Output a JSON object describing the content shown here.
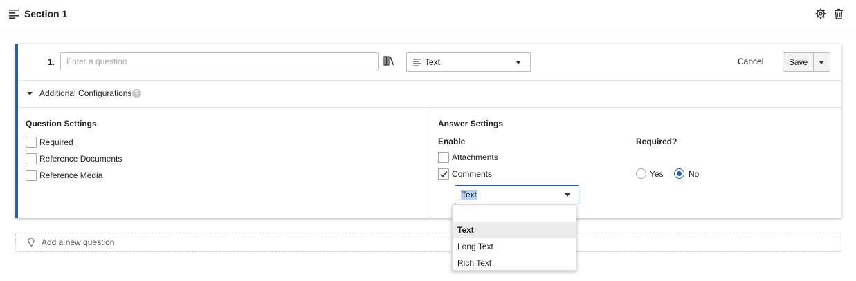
{
  "section": {
    "title": "Section 1"
  },
  "question": {
    "number": "1.",
    "placeholder": "Enter a question",
    "type_value": "Text",
    "cancel_label": "Cancel",
    "save_label": "Save"
  },
  "additional_config": {
    "label": "Additional Configurations",
    "help": "?"
  },
  "question_settings": {
    "heading": "Question Settings",
    "options": [
      {
        "label": "Required",
        "checked": false
      },
      {
        "label": "Reference Documents",
        "checked": false
      },
      {
        "label": "Reference Media",
        "checked": false
      }
    ]
  },
  "answer_settings": {
    "heading": "Answer Settings",
    "enable_heading": "Enable",
    "required_heading": "Required?",
    "attachments_label": "Attachments",
    "attachments_checked": false,
    "comments_label": "Comments",
    "comments_checked": true,
    "radio_yes": "Yes",
    "radio_no": "No",
    "selected_required": "No",
    "comment_type_value": "Text"
  },
  "dropdown": {
    "options": [
      "Text",
      "Long Text",
      "Rich Text"
    ],
    "selected": "Text"
  },
  "add_question": {
    "label": "Add a new question"
  },
  "colors": {
    "accent": "#2a5bb5",
    "selection_highlight": "#b5d1f5"
  }
}
